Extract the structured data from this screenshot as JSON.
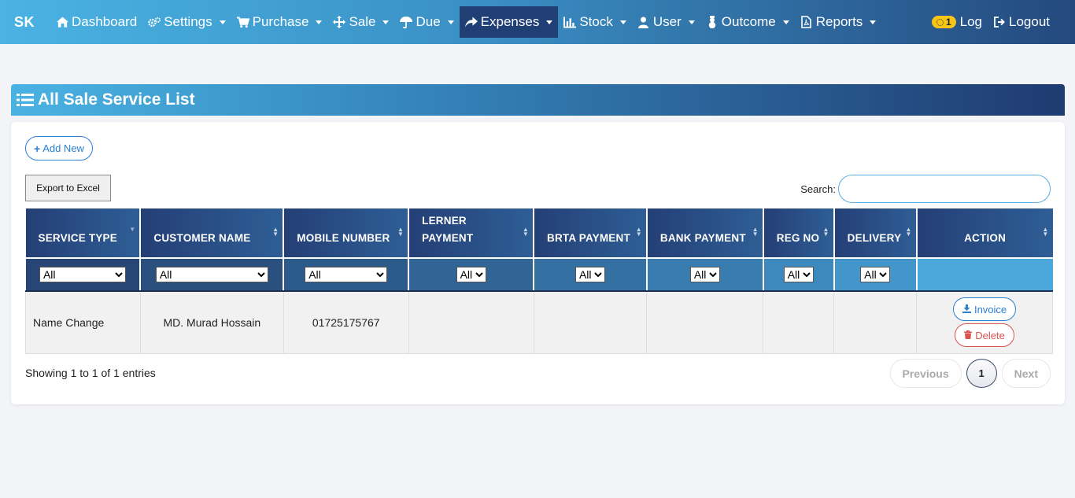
{
  "brand": "SK",
  "nav": {
    "items": [
      {
        "label": "Dashboard",
        "icon": "home-icon",
        "caret": false
      },
      {
        "label": "Settings",
        "icon": "gears-icon",
        "caret": true
      },
      {
        "label": "Purchase",
        "icon": "cart-icon",
        "caret": true
      },
      {
        "label": "Sale",
        "icon": "move-arrows-icon",
        "caret": true
      },
      {
        "label": "Due",
        "icon": "umbrella-icon",
        "caret": true
      },
      {
        "label": "Expenses",
        "icon": "share-arrow-icon",
        "caret": true,
        "active": true
      },
      {
        "label": "Stock",
        "icon": "bar-chart-icon",
        "caret": true
      },
      {
        "label": "User",
        "icon": "user-icon",
        "caret": true
      },
      {
        "label": "Outcome",
        "icon": "snowman-icon",
        "caret": true
      },
      {
        "label": "Reports",
        "icon": "pdf-file-icon",
        "caret": true
      }
    ],
    "log_badge": "1",
    "log_label": "Log",
    "logout_label": "Logout"
  },
  "page": {
    "title": "All Sale Service List",
    "add_new": "Add New",
    "export_excel": "Export to Excel",
    "search_label": "Search:",
    "search_value": ""
  },
  "table": {
    "columns": [
      "SERVICE TYPE",
      "CUSTOMER NAME",
      "MOBILE NUMBER",
      "LERNER PAYMENT",
      "BRTA PAYMENT",
      "BANK PAYMENT",
      "REG NO",
      "DELIVERY",
      "ACTION"
    ],
    "filter_default": "All",
    "rows": [
      {
        "service_type": "Name Change",
        "customer_name": "MD. Murad Hossain",
        "mobile": "01725175767",
        "lerner_payment": "",
        "brta_payment": "",
        "bank_payment": "",
        "reg_no": "",
        "delivery": ""
      }
    ],
    "invoice_label": "Invoice",
    "delete_label": "Delete"
  },
  "footer": {
    "info": "Showing 1 to 1 of 1 entries",
    "previous": "Previous",
    "page": "1",
    "next": "Next"
  },
  "colors": {
    "accent": "#2a7fd4",
    "danger": "#d9534f",
    "nav_active": "#1f3f75"
  }
}
